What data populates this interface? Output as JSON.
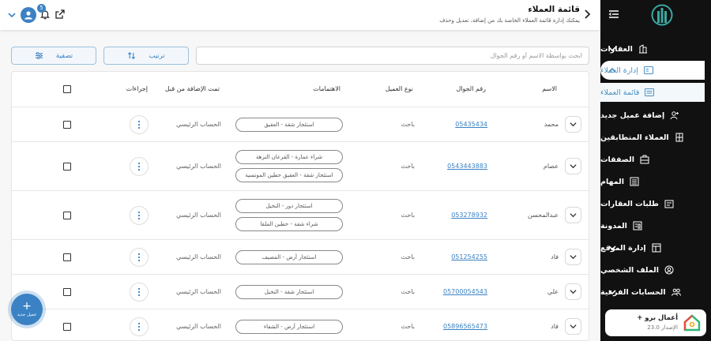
{
  "header": {
    "title": "قائمة العملاء",
    "subtitle": "يمكنك إدارة قائمة العملاء الخاصة بك من إضافة، تعديل وحذف",
    "notification_count": "5"
  },
  "toolbar": {
    "search_placeholder": "ابحث بواسطة الاسم أو رقم الجوال",
    "sort_label": "ترتيب",
    "filter_label": "تصفية"
  },
  "table": {
    "headers": {
      "name": "الاسم",
      "phone": "رقم الجوال",
      "client_type": "نوع العميل",
      "interests": "الاهتمامات",
      "added_by": "تمت الإضافة من قبل",
      "actions": "إجراءات"
    },
    "rows": [
      {
        "name": "محمد",
        "phone": "05435434",
        "type": "باحث",
        "interests": [
          "استئجار شقة - العقيق"
        ],
        "added_by": "الحساب الرئيسي"
      },
      {
        "name": "عصام",
        "phone": "0543443883",
        "type": "باحث",
        "interests": [
          "شراء عمارة - القرعان النزهة",
          "استئجار شقة - العقيق حطين المونسية"
        ],
        "added_by": "الحساب الرئيسي"
      },
      {
        "name": "عبدالمحسن",
        "phone": "053278932",
        "type": "باحث",
        "interests": [
          "استئجار دور - النخيل",
          "شراء شقة - حطين الملقا"
        ],
        "added_by": "الحساب الرئيسي"
      },
      {
        "name": "فاد",
        "phone": "051254255",
        "type": "باحث",
        "interests": [
          "استئجار أرض - المصيف"
        ],
        "added_by": "الحساب الرئيسي"
      },
      {
        "name": "علي",
        "phone": "05700054543",
        "type": "باحث",
        "interests": [
          "استئجار شقة - النخيل"
        ],
        "added_by": "الحساب الرئيسي"
      },
      {
        "name": "فاد",
        "phone": "05896565473",
        "type": "باحث",
        "interests": [
          "استئجار أرض - الشفاء"
        ],
        "added_by": "الحساب الرئيسي"
      }
    ]
  },
  "fab": {
    "label": "عميل جديد"
  },
  "sidebar": {
    "items": [
      {
        "label": "العقارات"
      },
      {
        "label": "إدارة العملاء"
      },
      {
        "label": "قائمة العملاء"
      },
      {
        "label": "إضافة عميل جديد"
      },
      {
        "label": "العملاء المتطابقين"
      },
      {
        "label": "الصفقات"
      },
      {
        "label": "المهام"
      },
      {
        "label": "طلبات العقارات"
      },
      {
        "label": "المدونة"
      },
      {
        "label": "إدارة الموقع"
      },
      {
        "label": "الملف الشخصي"
      },
      {
        "label": "الحسابات الفرعية"
      }
    ],
    "card": {
      "title": "أعمال برو +",
      "version": "الإصدار 23.0"
    }
  },
  "colors": {
    "accent": "#3b82c4",
    "sidebar_bg": "#111111"
  }
}
